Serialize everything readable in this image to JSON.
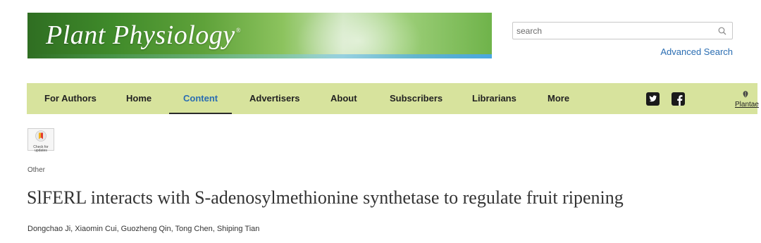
{
  "header": {
    "journal_title": "Plant Physiology",
    "trademark": "®",
    "search": {
      "placeholder": "search",
      "value": ""
    },
    "advanced_search_label": "Advanced Search"
  },
  "nav": {
    "items": [
      {
        "label": "For Authors",
        "active": false
      },
      {
        "label": "Home",
        "active": false
      },
      {
        "label": "Content",
        "active": true
      },
      {
        "label": "Advertisers",
        "active": false
      },
      {
        "label": "About",
        "active": false
      },
      {
        "label": "Subscribers",
        "active": false
      },
      {
        "label": "Librarians",
        "active": false
      },
      {
        "label": "More",
        "active": false
      }
    ],
    "social": [
      "twitter-icon",
      "facebook-icon"
    ],
    "plantae_label": "Plantae"
  },
  "article": {
    "check_updates_label": "Check for updates",
    "type": "Other",
    "title": "SlFERL interacts with S-adenosylmethionine synthetase to regulate fruit ripening",
    "authors": "Dongchao Ji, Xiaomin Cui, Guozheng Qin, Tong Chen, Shiping Tian"
  },
  "colors": {
    "nav_background": "#d7e39d",
    "link": "#2a6db2",
    "banner_green": "#3f8a2a"
  }
}
